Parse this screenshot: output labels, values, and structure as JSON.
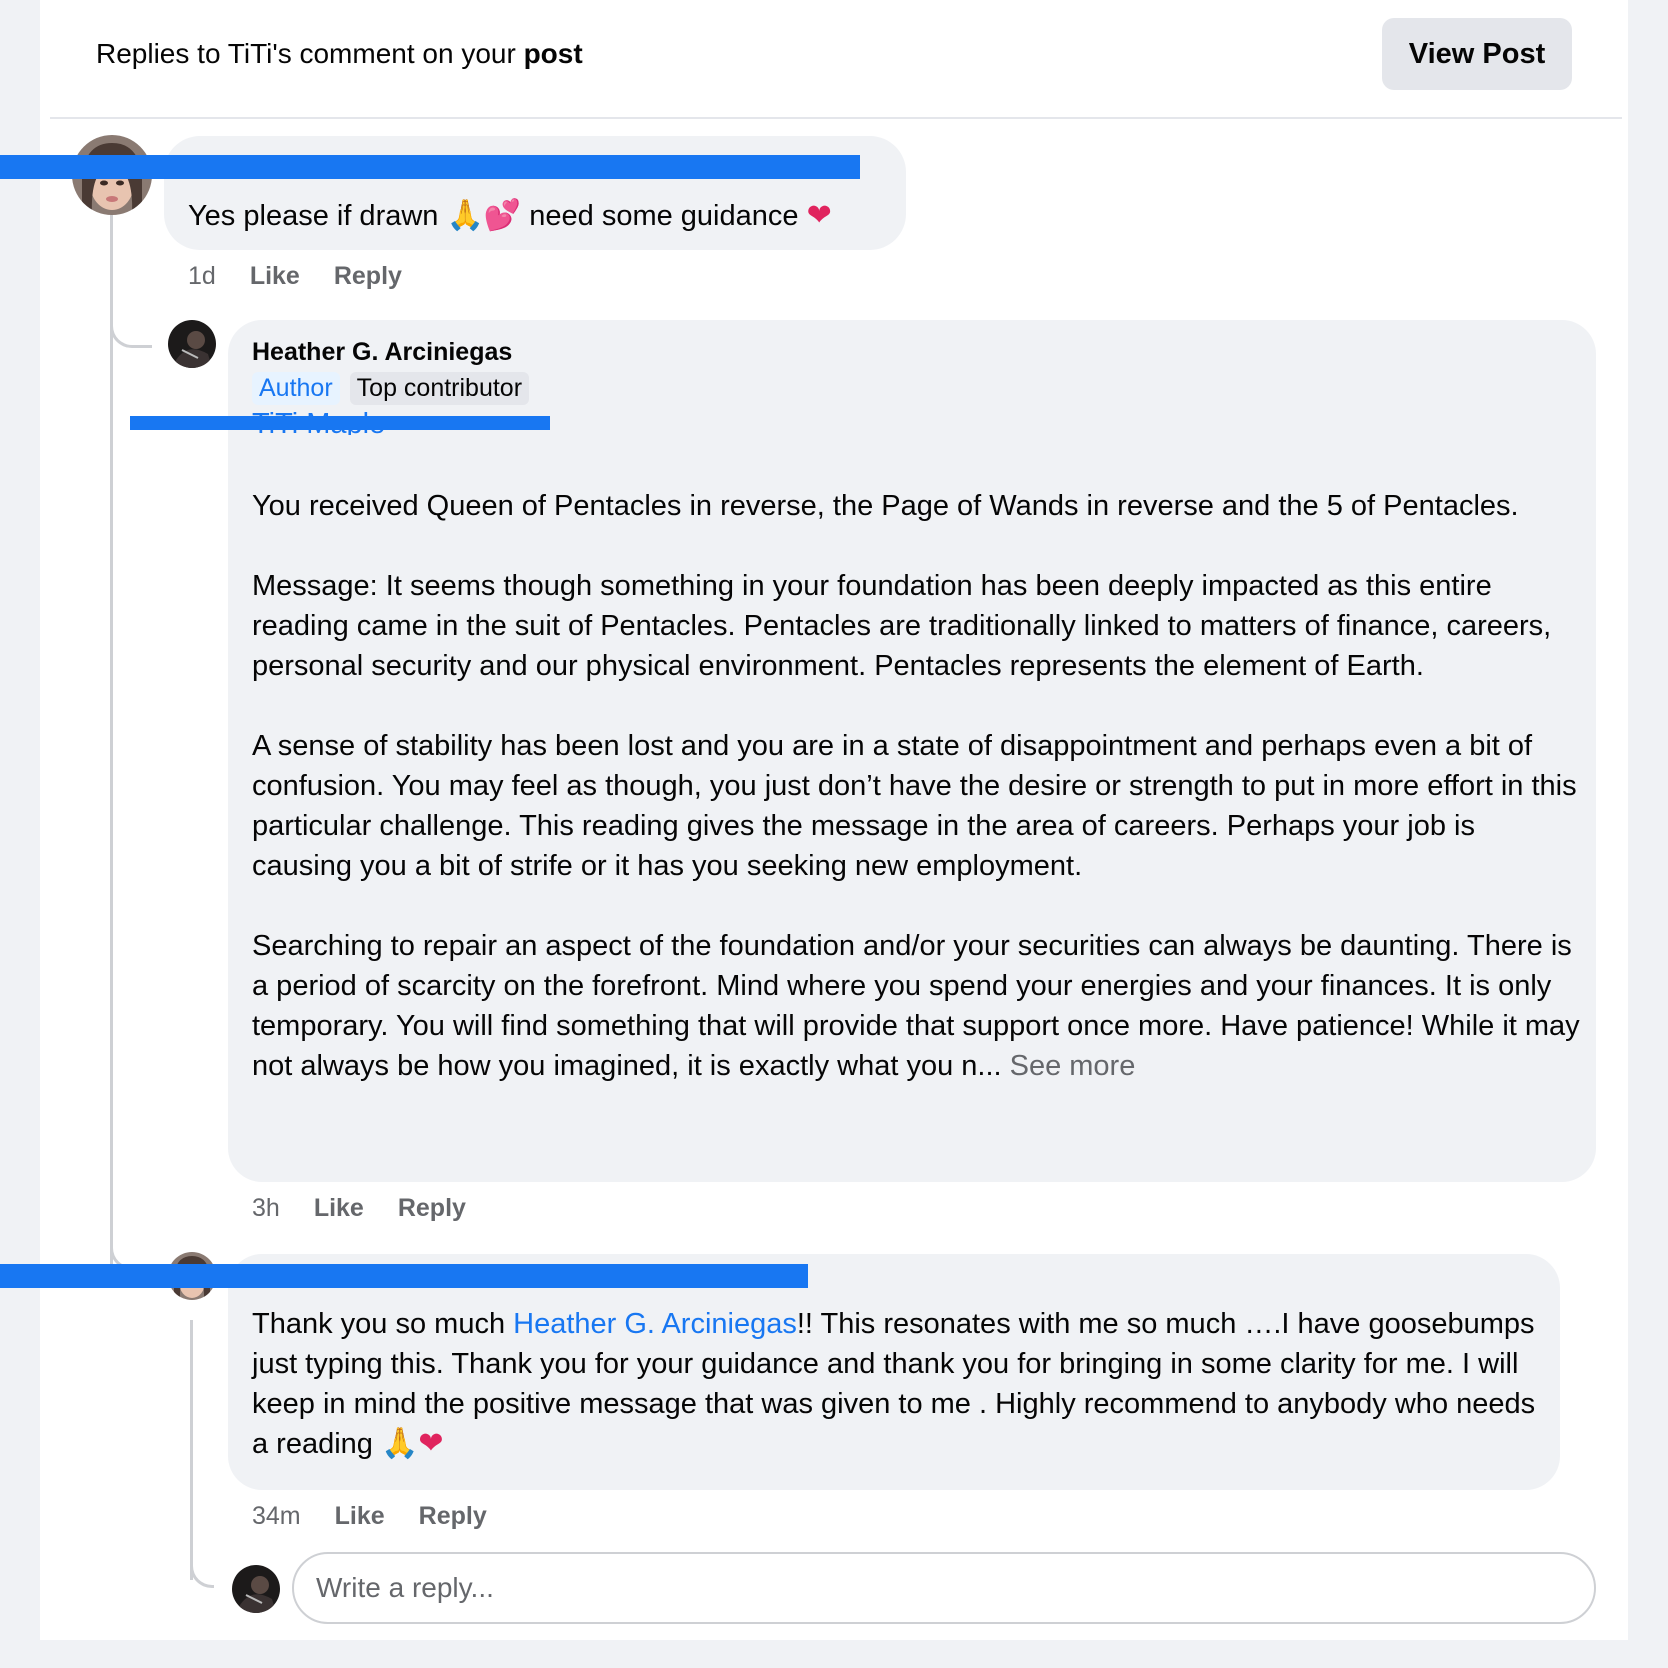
{
  "header": {
    "prefix": "Replies to TiTi's comment on your ",
    "bold": "post",
    "view_post_label": "View Post"
  },
  "comment1": {
    "text_before": "Yes please if drawn ",
    "emoji1": "🙏💕",
    "text_after": " need some guidance ",
    "emoji2": "❤",
    "time": "1d",
    "like": "Like",
    "reply": "Reply"
  },
  "comment2": {
    "author": "Heather G. Arciniegas",
    "badge_author": "Author",
    "badge_top": "Top contributor",
    "mention_partial": "TiTi Maple",
    "paragraphs": [
      "You received Queen of Pentacles in reverse, the Page of Wands in reverse and the 5 of Pentacles.",
      "Message: It seems though something in your foundation has been deeply impacted as this entire reading came in the suit of Pentacles. Pentacles are traditionally linked to matters of finance, careers, personal security and our physical environment. Pentacles represents the element of Earth.",
      "A sense of stability has been lost and you are in a state of disappointment and perhaps even a bit of confusion. You may feel as though, you just don’t have the desire or strength to put in more effort in this particular challenge. This reading gives the message in the area of careers. Perhaps your job is causing you a bit of strife or it has you seeking new employment.",
      "Searching to repair an aspect of the foundation and/or your securities can always be daunting. There is a period of scarcity on the forefront. Mind where you spend your energies and your finances. It is only temporary. You will find something that will provide that support once more. Have patience! While it may not always be how you imagined, it is exactly what you n..."
    ],
    "see_more": " See more",
    "time": "3h",
    "like": "Like",
    "reply": "Reply"
  },
  "comment3": {
    "text_before": "Thank you so much ",
    "mention": "Heather G. Arciniegas",
    "text_after": "!! This resonates with me so much ….I have goosebumps just typing this.  Thank you for your guidance and thank you for bringing in some clarity for me. I will keep in mind the positive message that was given to me .   Highly recommend to anybody who needs a reading ",
    "emoji": "🙏",
    "heart": "❤",
    "time": "34m",
    "like": "Like",
    "reply": "Reply"
  },
  "reply_box": {
    "placeholder": "Write a reply..."
  },
  "colors": {
    "accent": "#1877f2",
    "bubble": "#f0f2f5",
    "muted": "#65676b",
    "redaction": "#1877f2"
  }
}
